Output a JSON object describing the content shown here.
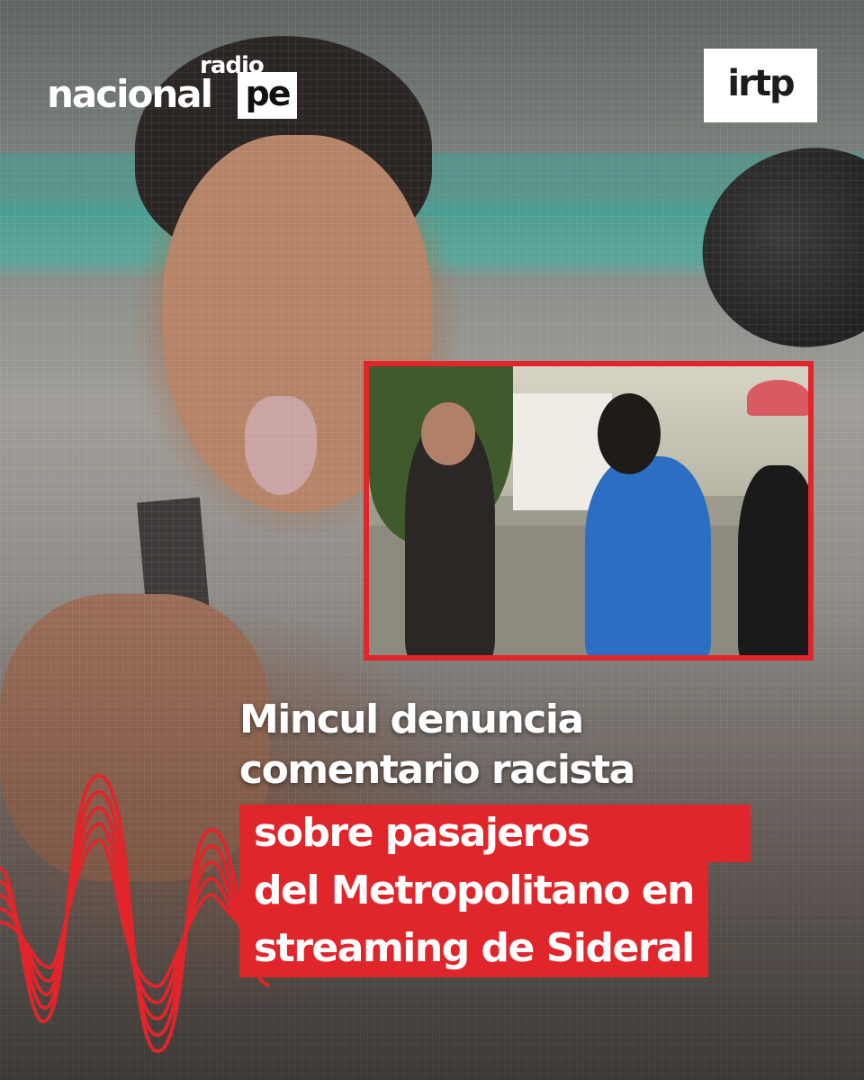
{
  "logos": {
    "radio_nacional": {
      "radio": "radio",
      "nacional": "nacional",
      "pe": "pe"
    },
    "irtp": "irtp"
  },
  "headline": {
    "line1": "Mincul denuncia",
    "line2": "comentario racista",
    "line3": "sobre pasajeros",
    "line4": "del Metropolitano en",
    "line5": "streaming de Sideral"
  },
  "colors": {
    "accent_red": "#e0252b",
    "text": "#ffffff"
  },
  "icons": {
    "wave": "sound-wave-icon"
  }
}
